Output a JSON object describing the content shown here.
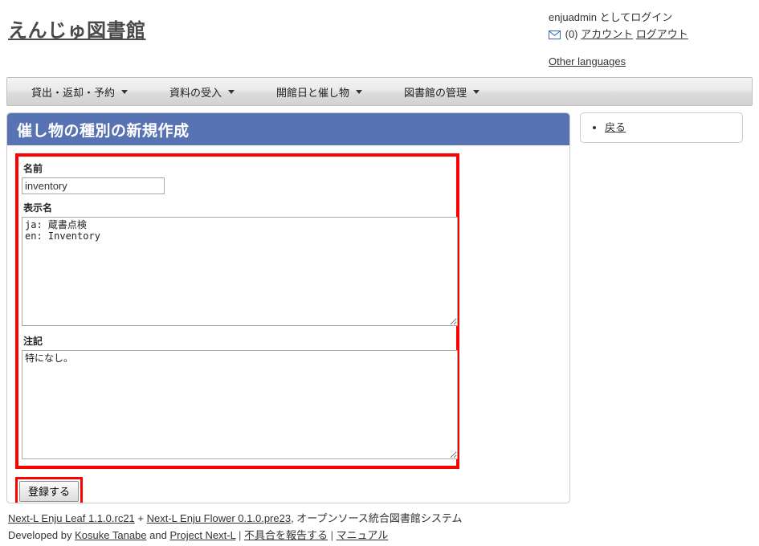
{
  "header": {
    "site_title": "えんじゅ図書館",
    "logged_in_as": "enjuadmin としてログイン",
    "message_icon": "envelope-icon",
    "message_count": "(0)",
    "account_label": "アカウント",
    "logout_label": "ログアウト",
    "other_languages_label": "Other languages"
  },
  "nav": {
    "items": [
      {
        "label": "貸出・返却・予約"
      },
      {
        "label": "資料の受入"
      },
      {
        "label": "開館日と催し物"
      },
      {
        "label": "図書館の管理"
      }
    ]
  },
  "page": {
    "title": "催し物の種別の新規作成",
    "accent_color": "#5873b4",
    "highlight_color": "#fe0000"
  },
  "form": {
    "name_label": "名前",
    "name_value": "inventory",
    "name_placeholder": "",
    "display_name_label": "表示名",
    "display_name_line1_lang": "ja:",
    "display_name_line1_value": " 蔵書点検",
    "display_name_line2": "en: Inventory",
    "display_name_placeholder": "",
    "note_label": "注記",
    "note_value": "特になし。",
    "note_placeholder": "",
    "submit_label": "登録する"
  },
  "sidebar": {
    "items": [
      {
        "label": "戻る"
      }
    ]
  },
  "footer": {
    "leaf_link": "Next-L Enju Leaf 1.1.0.rc21",
    "plus": "+",
    "flower_link": "Next-L Enju Flower 0.1.0.pre23",
    "tagline": ", オープンソース統合図書館システム",
    "developed_by": "Developed by",
    "author_link": "Kosuke Tanabe",
    "and": "and",
    "project_link": "Project Next-L",
    "sep1": "|",
    "bug_link": "不具合を報告する",
    "sep2": "|",
    "manual_link": "マニュアル"
  }
}
